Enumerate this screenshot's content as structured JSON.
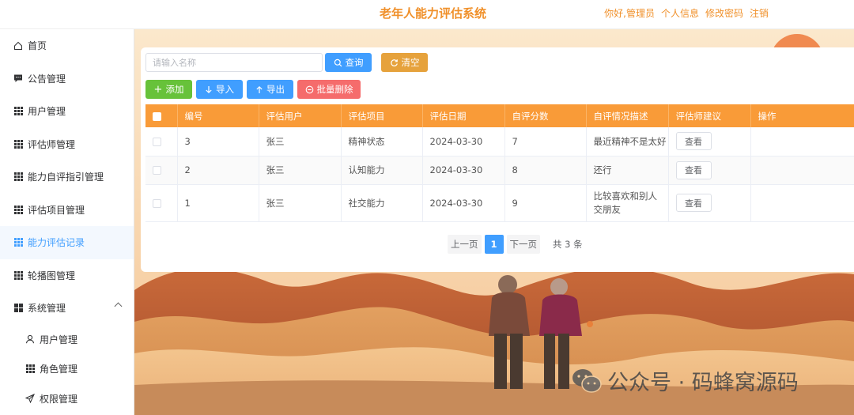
{
  "header": {
    "title": "老年人能力评估系统",
    "greeting": "你好,管理员",
    "profile_link": "个人信息",
    "password_link": "修改密码",
    "logout_link": "注销"
  },
  "sidebar": {
    "items": [
      {
        "label": "首页",
        "icon": "home-icon"
      },
      {
        "label": "公告管理",
        "icon": "message-icon"
      },
      {
        "label": "用户管理",
        "icon": "grid-icon"
      },
      {
        "label": "评估师管理",
        "icon": "grid-icon"
      },
      {
        "label": "能力自评指引管理",
        "icon": "grid-icon"
      },
      {
        "label": "评估项目管理",
        "icon": "grid-icon"
      },
      {
        "label": "能力评估记录",
        "icon": "grid-icon",
        "active": true
      },
      {
        "label": "轮播图管理",
        "icon": "grid-icon"
      },
      {
        "label": "系统管理",
        "icon": "grid4-icon",
        "expanded": true
      }
    ],
    "sub_items": [
      {
        "label": "用户管理",
        "icon": "user-icon"
      },
      {
        "label": "角色管理",
        "icon": "grid-icon"
      },
      {
        "label": "权限管理",
        "icon": "send-icon"
      }
    ]
  },
  "search": {
    "placeholder": "请输入名称",
    "query_label": "查询",
    "clear_label": "清空"
  },
  "actions": {
    "add_label": "添加",
    "import_label": "导入",
    "export_label": "导出",
    "batch_delete_label": "批量删除"
  },
  "table": {
    "headers": [
      "编号",
      "评估用户",
      "评估项目",
      "评估日期",
      "自评分数",
      "自评情况描述",
      "评估师建议",
      "操作"
    ],
    "view_label": "查看",
    "rows": [
      {
        "id": "3",
        "user": "张三",
        "project": "精神状态",
        "date": "2024-03-30",
        "score": "7",
        "desc": "最近精神不是太好"
      },
      {
        "id": "2",
        "user": "张三",
        "project": "认知能力",
        "date": "2024-03-30",
        "score": "8",
        "desc": "还行"
      },
      {
        "id": "1",
        "user": "张三",
        "project": "社交能力",
        "date": "2024-03-30",
        "score": "9",
        "desc": "比较喜欢和别人交朋友"
      }
    ]
  },
  "pagination": {
    "prev_label": "上一页",
    "current_page": "1",
    "next_label": "下一页",
    "total_text": "共 3 条"
  },
  "watermark": {
    "text": "公众号 · 码蜂窝源码"
  },
  "colors": {
    "accent": "#f0902a",
    "table_header": "#f99b38",
    "primary": "#409eff",
    "success": "#67c23a",
    "warning": "#e6a23c",
    "danger": "#f56c6c"
  }
}
